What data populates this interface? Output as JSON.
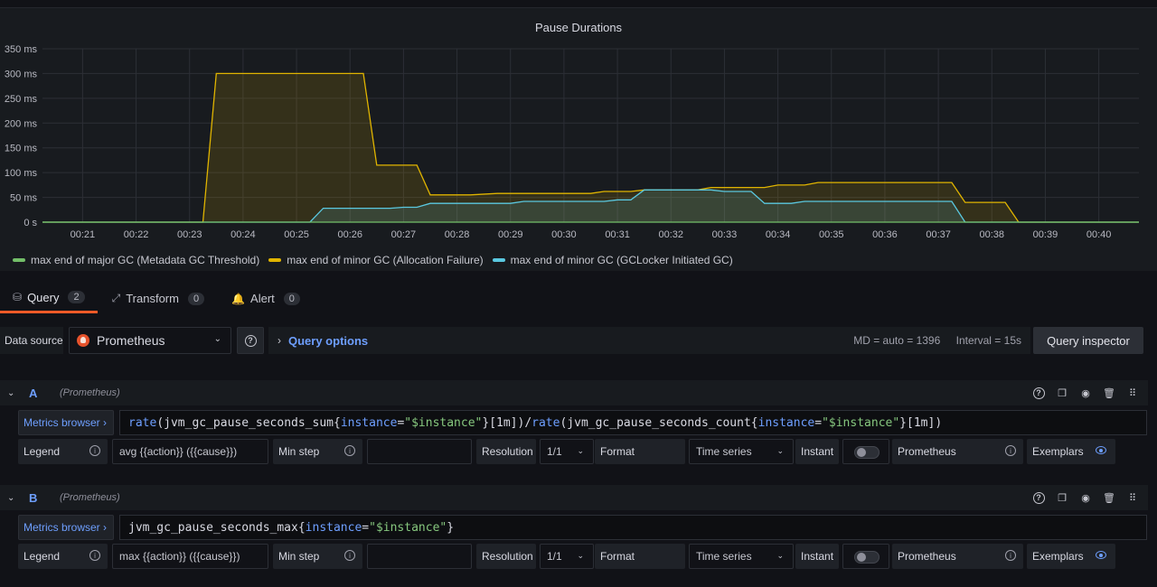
{
  "panel": {
    "title": "Pause Durations"
  },
  "chart_data": {
    "type": "line",
    "title": "Pause Durations",
    "x_ticks": [
      "00:21",
      "00:22",
      "00:23",
      "00:24",
      "00:25",
      "00:26",
      "00:27",
      "00:28",
      "00:29",
      "00:30",
      "00:31",
      "00:32",
      "00:33",
      "00:34",
      "00:35",
      "00:36",
      "00:37",
      "00:38",
      "00:39",
      "00:40"
    ],
    "y_ticks": [
      "0 s",
      "50 ms",
      "100 ms",
      "150 ms",
      "200 ms",
      "250 ms",
      "300 ms",
      "350 ms"
    ],
    "xlim": [
      "00:20:15",
      "00:40:45"
    ],
    "ylim": [
      0,
      350
    ],
    "series": [
      {
        "name": "max end of major GC (Metadata GC Threshold)",
        "color": "#73bf69",
        "fill": false,
        "x": [
          "00:20:15",
          "00:40:45"
        ],
        "y": [
          0,
          0
        ]
      },
      {
        "name": "max end of minor GC (Allocation Failure)",
        "color": "#e0b400",
        "fill": true,
        "x": [
          "00:20:15",
          "00:23:15",
          "00:23:30",
          "00:26:15",
          "00:26:30",
          "00:27:15",
          "00:27:30",
          "00:28:15",
          "00:28:45",
          "00:30:30",
          "00:30:45",
          "00:31:15",
          "00:31:30",
          "00:32:30",
          "00:32:45",
          "00:33:45",
          "00:34:00",
          "00:34:30",
          "00:34:45",
          "00:37:15",
          "00:37:30",
          "00:38:15",
          "00:38:30",
          "00:40:45"
        ],
        "y": [
          0,
          0,
          300,
          300,
          115,
          115,
          55,
          55,
          58,
          58,
          62,
          62,
          65,
          65,
          70,
          70,
          75,
          75,
          80,
          80,
          40,
          40,
          0,
          0
        ]
      },
      {
        "name": "max end of minor GC (GCLocker Initiated GC)",
        "color": "#5ac8e0",
        "fill": true,
        "x": [
          "00:20:15",
          "00:25:15",
          "00:25:30",
          "00:26:45",
          "00:27:00",
          "00:27:15",
          "00:27:30",
          "00:29:00",
          "00:29:15",
          "00:30:45",
          "00:31:00",
          "00:31:15",
          "00:31:30",
          "00:32:45",
          "00:33:00",
          "00:33:30",
          "00:33:45",
          "00:34:15",
          "00:34:30",
          "00:37:15",
          "00:37:30",
          "00:40:45"
        ],
        "y": [
          0,
          0,
          28,
          28,
          30,
          30,
          38,
          38,
          42,
          42,
          45,
          45,
          65,
          65,
          62,
          62,
          38,
          38,
          42,
          42,
          0,
          0
        ]
      }
    ],
    "grid": true,
    "legend": "bottom-left"
  },
  "tabs": [
    {
      "label": "Query",
      "count": "2",
      "icon": "database-icon"
    },
    {
      "label": "Transform",
      "count": "0",
      "icon": "transform-icon"
    },
    {
      "label": "Alert",
      "count": "0",
      "icon": "bell-icon"
    }
  ],
  "datasource": {
    "label": "Data source",
    "selected": "Prometheus",
    "query_options_label": "Query options",
    "md": "MD = auto = 1396",
    "interval": "Interval = 15s",
    "query_inspector_label": "Query inspector"
  },
  "queries": [
    {
      "ref": "A",
      "ds": "(Prometheus)",
      "metrics_browser": "Metrics browser",
      "expr_parts": [
        [
          "fn",
          "rate"
        ],
        [
          "pun",
          "("
        ],
        [
          "txt",
          "jvm_gc_pause_seconds_sum"
        ],
        [
          "pun",
          "{"
        ],
        [
          "lbl",
          "instance"
        ],
        [
          "pun",
          "="
        ],
        [
          "str",
          "\"$instance\""
        ],
        [
          "pun",
          "}"
        ],
        [
          "rng",
          "[1m]"
        ],
        [
          "pun",
          ")/"
        ],
        [
          "fn",
          "rate"
        ],
        [
          "pun",
          "("
        ],
        [
          "txt",
          "jvm_gc_pause_seconds_count"
        ],
        [
          "pun",
          "{"
        ],
        [
          "lbl",
          "instance"
        ],
        [
          "pun",
          "="
        ],
        [
          "str",
          "\"$instance\""
        ],
        [
          "pun",
          "}"
        ],
        [
          "rng",
          "[1m]"
        ],
        [
          "pun",
          ")"
        ]
      ],
      "legend_label": "Legend",
      "legend_value": "avg {{action}} ({{cause}})",
      "minstep_label": "Min step",
      "minstep_value": "",
      "resolution_label": "Resolution",
      "resolution_value": "1/1",
      "format_label": "Format",
      "format_value": "Time series",
      "instant_label": "Instant",
      "type_label": "Prometheus",
      "exemplars_label": "Exemplars"
    },
    {
      "ref": "B",
      "ds": "(Prometheus)",
      "metrics_browser": "Metrics browser",
      "expr_parts": [
        [
          "txt",
          "jvm_gc_pause_seconds_max"
        ],
        [
          "pun",
          "{"
        ],
        [
          "lbl",
          "instance"
        ],
        [
          "pun",
          "="
        ],
        [
          "str",
          "\"$instance\""
        ],
        [
          "pun",
          "}"
        ]
      ],
      "legend_label": "Legend",
      "legend_value": "max {{action}} ({{cause}})",
      "minstep_label": "Min step",
      "minstep_value": "",
      "resolution_label": "Resolution",
      "resolution_value": "1/1",
      "format_label": "Format",
      "format_value": "Time series",
      "instant_label": "Instant",
      "type_label": "Prometheus",
      "exemplars_label": "Exemplars"
    }
  ]
}
